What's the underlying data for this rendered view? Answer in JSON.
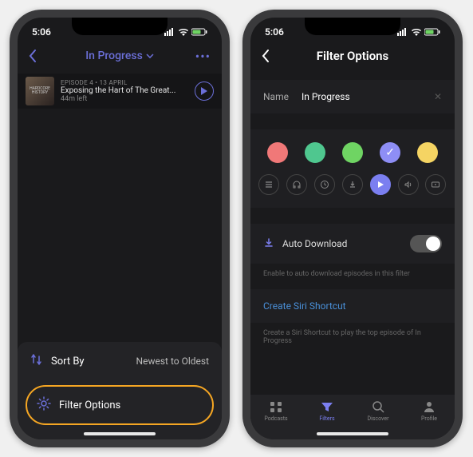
{
  "status": {
    "time": "5:06"
  },
  "left": {
    "nav_title": "In Progress",
    "episode": {
      "meta": "EPISODE 4 • 13 APRIL",
      "title": "Exposing the Hart of The Great...",
      "time_left": "44m left"
    },
    "sheet": {
      "sort_label": "Sort By",
      "sort_value": "Newest to Oldest",
      "filter_label": "Filter Options"
    }
  },
  "right": {
    "nav_title": "Filter Options",
    "name_label": "Name",
    "name_value": "In Progress",
    "colors": [
      "#f07878",
      "#4fc78f",
      "#6fd463",
      "#8e8ef5",
      "#f5d463"
    ],
    "selected_color_index": 3,
    "auto_download_label": "Auto Download",
    "auto_download_hint": "Enable to auto download episodes in this filter",
    "siri_label": "Create Siri Shortcut",
    "siri_hint": "Create a Siri Shortcut to play the top episode of In Progress",
    "tabs": {
      "podcasts": "Podcasts",
      "filters": "Filters",
      "discover": "Discover",
      "profile": "Profile"
    }
  }
}
